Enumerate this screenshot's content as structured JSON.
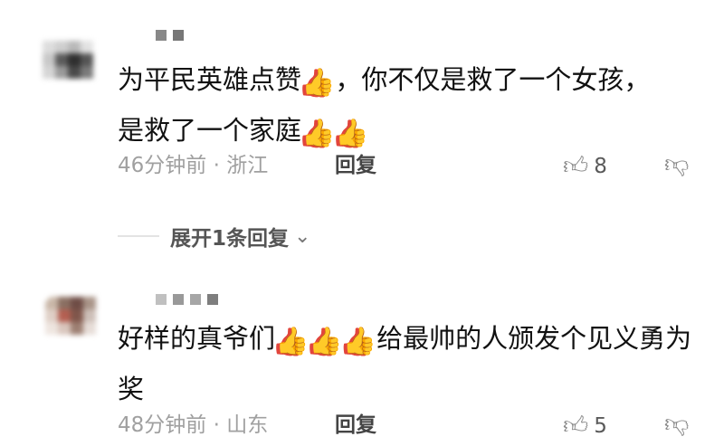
{
  "comments": [
    {
      "text": "为平民英雄点赞",
      "text_b": "，你不仅是救了一个女孩，是救了一个家庭",
      "time": "46分钟前",
      "location": "· 浙江",
      "reply_label": "回复",
      "likes": "8"
    },
    {
      "text": "好样的真爷们",
      "text_b": "给最帅的人颁发个见义勇为奖",
      "time": "48分钟前",
      "location": "· 山东",
      "reply_label": "回复",
      "likes": "5"
    }
  ],
  "expand_replies_label": "展开1条回复",
  "icons": {
    "thumbs_emoji": "👍",
    "like_icon": "👍︎",
    "dislike_icon": "👎︎",
    "chevron": "⌄"
  },
  "colors": {
    "text": "#111111",
    "meta": "#a0a0a0",
    "emoji": "#f2a21a"
  }
}
